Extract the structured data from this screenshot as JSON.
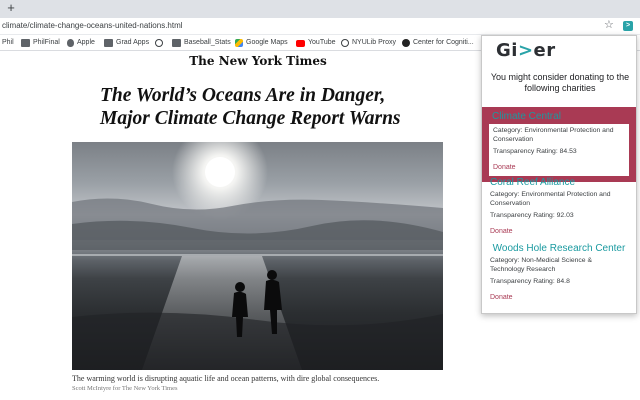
{
  "browser": {
    "new_tab": "+",
    "url": "climate/climate-change-oceans-united-nations.html",
    "star": "☆",
    "ext_label": ">"
  },
  "bookmarks": [
    {
      "label": "Phil",
      "icon": "none"
    },
    {
      "label": "PhilFinal",
      "icon": "folder"
    },
    {
      "label": "Apple",
      "icon": "apple"
    },
    {
      "label": "Grad Apps",
      "icon": "folder"
    },
    {
      "label": "",
      "icon": "globe"
    },
    {
      "label": "Baseball_Stats",
      "icon": "folder"
    },
    {
      "label": "Google Maps",
      "icon": "maps"
    },
    {
      "label": "YouTube",
      "icon": "youtube"
    },
    {
      "label": "NYULib Proxy",
      "icon": "globe"
    },
    {
      "label": "Center for Cogniti...",
      "icon": "dark"
    }
  ],
  "article": {
    "masthead": "The New York Times",
    "headline": "The World’s Oceans Are in Danger, Major Climate Change Report Warns",
    "caption": "The warming world is disrupting aquatic life and ocean patterns, with dire global consequences.",
    "credit": "Scott McIntyre for The New York Times"
  },
  "popup": {
    "logo_start": "Gi",
    "logo_arrow": ">",
    "logo_end": "er",
    "intro": "You might consider donating to the following charities",
    "charities": [
      {
        "name": "Climate Central",
        "category": "Category: Environmental Protection and Conservation",
        "rating": "Transparency Rating: 84.53",
        "donate": "Donate"
      },
      {
        "name": "Coral Reef Alliance",
        "category": "Category: Environmental Protection and Conservation",
        "rating": "Transparency Rating: 92.03",
        "donate": "Donate"
      },
      {
        "name": "Woods Hole Research Center",
        "category": "Category: Non-Medical Science & Technology Research",
        "rating": "Transparency Rating: 84.8",
        "donate": "Donate"
      }
    ]
  },
  "colors": {
    "accent": "#1a9aa0",
    "highlight": "#a93a54"
  }
}
